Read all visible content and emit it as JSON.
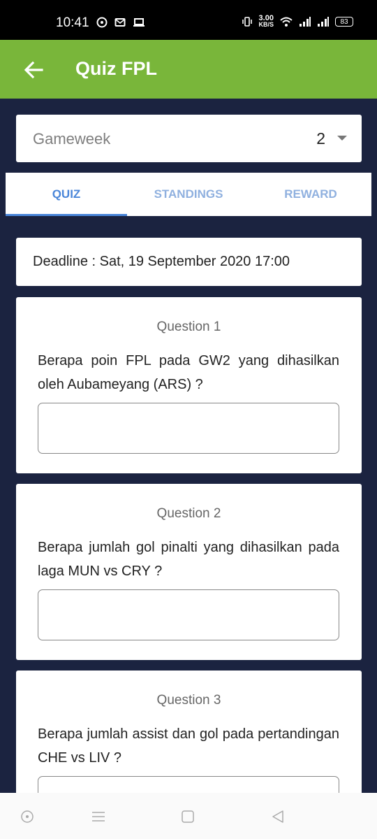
{
  "status_bar": {
    "time": "10:41",
    "net_speed_value": "3.00",
    "net_speed_unit": "KB/S",
    "battery": "83"
  },
  "app_bar": {
    "title": "Quiz FPL",
    "color": "#79b63a"
  },
  "gameweek": {
    "label": "Gameweek",
    "value": "2"
  },
  "tabs": [
    {
      "label": "QUIZ",
      "active": true
    },
    {
      "label": "STANDINGS",
      "active": false
    },
    {
      "label": "REWARD",
      "active": false
    }
  ],
  "deadline": {
    "text": "Deadline : Sat, 19 September 2020 17:00"
  },
  "questions": [
    {
      "title": "Question 1",
      "text": "Berapa poin FPL pada GW2 yang dihasilkan oleh Aubameyang (ARS) ?",
      "answer": ""
    },
    {
      "title": "Question 2",
      "text": "Berapa jumlah gol pinalti yang dihasilkan pada laga MUN vs CRY ?",
      "answer": ""
    },
    {
      "title": "Question 3",
      "text": "Berapa jumlah assist dan gol pada pertandingan CHE vs LIV ?",
      "answer": ""
    }
  ],
  "colors": {
    "background": "#1b2340",
    "tab_active": "#4a86d9",
    "tab_inactive": "#8fb0df"
  }
}
